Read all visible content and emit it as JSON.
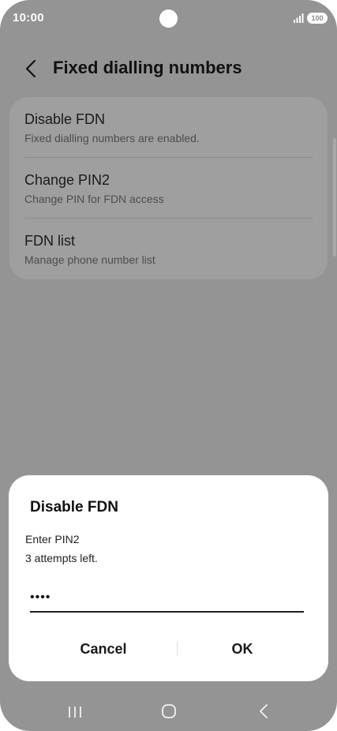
{
  "status_bar": {
    "time": "10:00",
    "battery": "100",
    "icons": [
      "signal-icon",
      "battery-icon"
    ]
  },
  "header": {
    "title": "Fixed dialling numbers",
    "back_icon": "chevron-left-icon"
  },
  "settings": {
    "items": [
      {
        "title": "Disable FDN",
        "subtitle": "Fixed dialling numbers are enabled."
      },
      {
        "title": "Change PIN2",
        "subtitle": "Change PIN for FDN access"
      },
      {
        "title": "FDN list",
        "subtitle": "Manage phone number list"
      }
    ]
  },
  "dialog": {
    "title": "Disable FDN",
    "message_line1": "Enter PIN2",
    "message_line2": "3 attempts left.",
    "pin_value": "1234",
    "cancel_label": "Cancel",
    "ok_label": "OK"
  },
  "nav_bar": {
    "icons": [
      "recents-icon",
      "home-icon",
      "back-icon"
    ]
  },
  "colors": {
    "overlay_bg": "#949494",
    "card_bg": "#9f9f9f",
    "dialog_bg": "#ffffff",
    "text_primary": "#111111"
  }
}
